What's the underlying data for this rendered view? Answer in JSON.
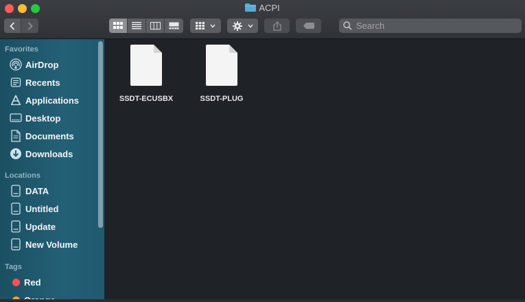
{
  "window": {
    "title": "ACPI"
  },
  "toolbar": {
    "search_placeholder": "Search"
  },
  "sidebar": {
    "favorites_header": "Favorites",
    "favorites": [
      {
        "label": "AirDrop",
        "icon": "airdrop-icon"
      },
      {
        "label": "Recents",
        "icon": "recents-icon"
      },
      {
        "label": "Applications",
        "icon": "applications-icon"
      },
      {
        "label": "Desktop",
        "icon": "desktop-icon"
      },
      {
        "label": "Documents",
        "icon": "documents-icon"
      },
      {
        "label": "Downloads",
        "icon": "downloads-icon"
      }
    ],
    "locations_header": "Locations",
    "locations": [
      {
        "label": "DATA",
        "icon": "disk-icon"
      },
      {
        "label": "Untitled",
        "icon": "disk-icon"
      },
      {
        "label": "Update",
        "icon": "disk-icon"
      },
      {
        "label": "New Volume",
        "icon": "disk-icon"
      }
    ],
    "tags_header": "Tags",
    "tags": [
      {
        "label": "Red",
        "color": "#ff5257"
      },
      {
        "label": "Orange",
        "color": "#f3a23a"
      }
    ]
  },
  "files": [
    {
      "name": "SSDT-ECUSBX"
    },
    {
      "name": "SSDT-PLUG"
    }
  ],
  "colors": {
    "sidebar": "#236076",
    "content_bg": "#1f2328",
    "folder_blue": "#5aa8d8"
  }
}
